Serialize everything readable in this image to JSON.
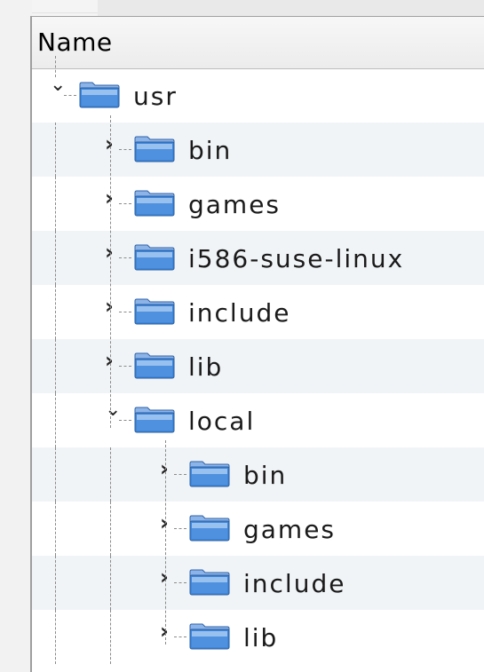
{
  "header": {
    "column_name": "Name"
  },
  "tree": [
    {
      "label": "usr",
      "depth": 0,
      "expanded": true,
      "icon": "folder-icon"
    },
    {
      "label": "bin",
      "depth": 1,
      "expanded": false,
      "icon": "folder-icon"
    },
    {
      "label": "games",
      "depth": 1,
      "expanded": false,
      "icon": "folder-icon"
    },
    {
      "label": "i586-suse-linux",
      "depth": 1,
      "expanded": false,
      "icon": "folder-icon"
    },
    {
      "label": "include",
      "depth": 1,
      "expanded": false,
      "icon": "folder-icon"
    },
    {
      "label": "lib",
      "depth": 1,
      "expanded": false,
      "icon": "folder-icon"
    },
    {
      "label": "local",
      "depth": 1,
      "expanded": true,
      "icon": "folder-icon"
    },
    {
      "label": "bin",
      "depth": 2,
      "expanded": false,
      "icon": "folder-icon"
    },
    {
      "label": "games",
      "depth": 2,
      "expanded": false,
      "icon": "folder-icon"
    },
    {
      "label": "include",
      "depth": 2,
      "expanded": false,
      "icon": "folder-icon"
    },
    {
      "label": "lib",
      "depth": 2,
      "expanded": false,
      "icon": "folder-icon"
    }
  ],
  "colors": {
    "folder_top": "#8db4e8",
    "folder_body": "#3f86d9",
    "row_alt": "#f1f4f7",
    "tree_line": "#8a8a8a"
  }
}
